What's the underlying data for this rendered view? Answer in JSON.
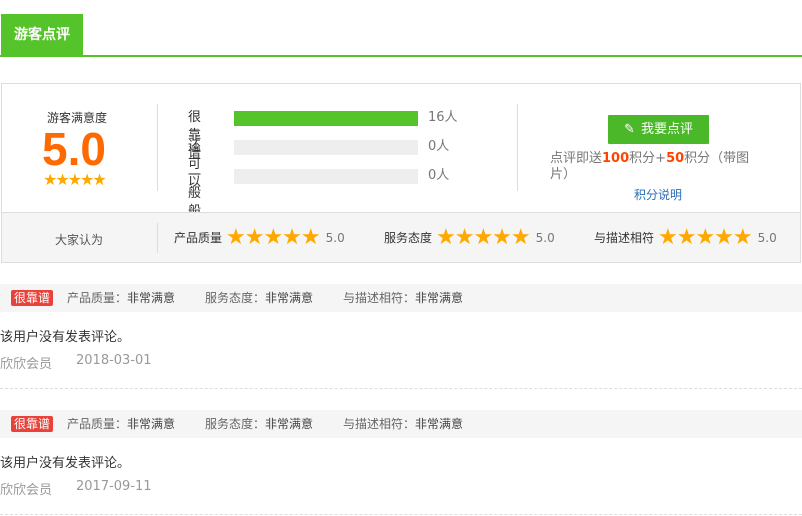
{
  "tab": {
    "label": "游客点评"
  },
  "summary": {
    "satisfaction_title": "游客满意度",
    "score": "5.0",
    "stars": "★★★★★",
    "ratings": [
      {
        "label": "很靠谱",
        "count": "16人",
        "fill": 1.0
      },
      {
        "label": "还可以",
        "count": "0人",
        "fill": 0
      },
      {
        "label": "一般般",
        "count": "0人",
        "fill": 0
      }
    ],
    "review_button": "我要点评",
    "promo_prefix": "点评即送",
    "promo_points1": "100",
    "promo_mid": "积分+",
    "promo_points2": "50",
    "promo_suffix": "积分（带图片）",
    "points_link": "积分说明",
    "opinion_label": "大家认为",
    "aspects": [
      {
        "name": "产品质量",
        "stars": "★★★★★",
        "score": "5.0"
      },
      {
        "name": "服务态度",
        "stars": "★★★★★",
        "score": "5.0"
      },
      {
        "name": "与描述相符",
        "stars": "★★★★★",
        "score": "5.0"
      }
    ]
  },
  "reviews": [
    {
      "badge": "很靠谱",
      "quality": "产品质量：",
      "quality_v": "非常满意",
      "service": "服务态度：",
      "service_v": "非常满意",
      "match": "与描述相符：",
      "match_v": "非常满意",
      "text": "该用户没有发表评论。",
      "user": "欣欣会员",
      "date": "2018-03-01"
    },
    {
      "badge": "很靠谱",
      "quality": "产品质量：",
      "quality_v": "非常满意",
      "service": "服务态度：",
      "service_v": "非常满意",
      "match": "与描述相符：",
      "match_v": "非常满意",
      "text": "该用户没有发表评论。",
      "user": "欣欣会员",
      "date": "2017-09-11"
    }
  ],
  "colors": {
    "accent": "#55c32a",
    "score": "#ff6a00",
    "star": "#ffa800",
    "badge": "#e8423a",
    "link": "#2a6fb8"
  }
}
